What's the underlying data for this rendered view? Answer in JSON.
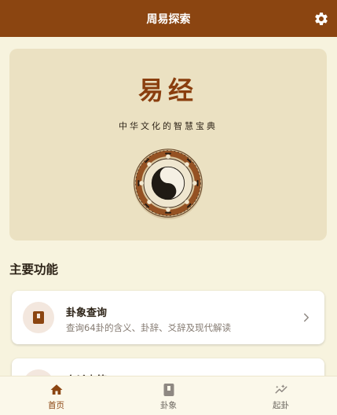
{
  "app": {
    "title": "周易探索"
  },
  "hero": {
    "title": "易经",
    "subtitle": "中华文化的智慧宝典"
  },
  "section": {
    "title": "主要功能"
  },
  "cards": [
    {
      "title": "卦象查询",
      "description": "查询64卦的含义、卦辞、爻辞及现代解读",
      "icon": "book-icon"
    },
    {
      "title": "六爻占筮",
      "description": "",
      "icon": "coin-icon"
    }
  ],
  "nav": {
    "items": [
      {
        "label": "首页",
        "icon": "home-icon",
        "active": true
      },
      {
        "label": "卦象",
        "icon": "book-icon",
        "active": false
      },
      {
        "label": "起卦",
        "icon": "insights-icon",
        "active": false
      }
    ]
  },
  "colors": {
    "primary": "#8b4511",
    "background": "#f7f3de",
    "hero_background": "#ebe1c2",
    "card_icon_background": "#f3e7de"
  }
}
